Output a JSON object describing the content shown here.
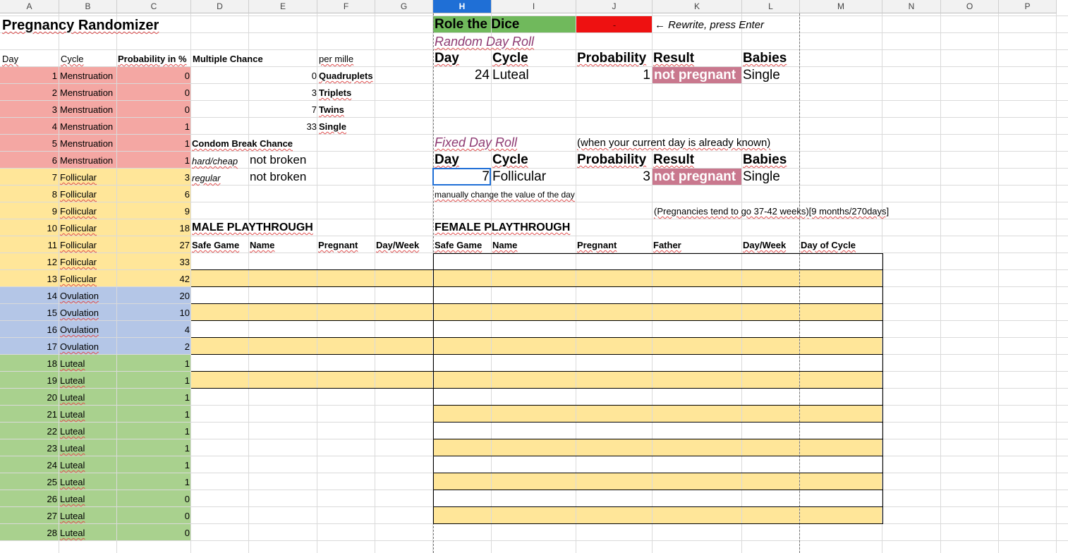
{
  "columns": [
    "A",
    "B",
    "C",
    "D",
    "E",
    "F",
    "G",
    "H",
    "I",
    "J",
    "K",
    "L",
    "M",
    "N",
    "O",
    "P"
  ],
  "selected_column": "H",
  "title": "Pregnancy Randomizer",
  "left_table": {
    "headers": {
      "day": "Day",
      "cycle": "Cycle",
      "probability": "Probability in %"
    },
    "rows": [
      {
        "day": "1",
        "cycle": "Menstruation",
        "prob": "0"
      },
      {
        "day": "2",
        "cycle": "Menstruation",
        "prob": "0"
      },
      {
        "day": "3",
        "cycle": "Menstruation",
        "prob": "0"
      },
      {
        "day": "4",
        "cycle": "Menstruation",
        "prob": "1"
      },
      {
        "day": "5",
        "cycle": "Menstruation",
        "prob": "1"
      },
      {
        "day": "6",
        "cycle": "Menstruation",
        "prob": "1"
      },
      {
        "day": "7",
        "cycle": "Follicular",
        "prob": "3"
      },
      {
        "day": "8",
        "cycle": "Follicular",
        "prob": "6"
      },
      {
        "day": "9",
        "cycle": "Follicular",
        "prob": "9"
      },
      {
        "day": "10",
        "cycle": "Follicular",
        "prob": "18"
      },
      {
        "day": "11",
        "cycle": "Follicular",
        "prob": "27"
      },
      {
        "day": "12",
        "cycle": "Follicular",
        "prob": "33"
      },
      {
        "day": "13",
        "cycle": "Follicular",
        "prob": "42"
      },
      {
        "day": "14",
        "cycle": "Ovulation",
        "prob": "20"
      },
      {
        "day": "15",
        "cycle": "Ovulation",
        "prob": "10"
      },
      {
        "day": "16",
        "cycle": "Ovulation",
        "prob": "4"
      },
      {
        "day": "17",
        "cycle": "Ovulation",
        "prob": "2"
      },
      {
        "day": "18",
        "cycle": "Luteal",
        "prob": "1"
      },
      {
        "day": "19",
        "cycle": "Luteal",
        "prob": "1"
      },
      {
        "day": "20",
        "cycle": "Luteal",
        "prob": "1"
      },
      {
        "day": "21",
        "cycle": "Luteal",
        "prob": "1"
      },
      {
        "day": "22",
        "cycle": "Luteal",
        "prob": "1"
      },
      {
        "day": "23",
        "cycle": "Luteal",
        "prob": "1"
      },
      {
        "day": "24",
        "cycle": "Luteal",
        "prob": "1"
      },
      {
        "day": "25",
        "cycle": "Luteal",
        "prob": "1"
      },
      {
        "day": "26",
        "cycle": "Luteal",
        "prob": "0"
      },
      {
        "day": "27",
        "cycle": "Luteal",
        "prob": "0"
      },
      {
        "day": "28",
        "cycle": "Luteal",
        "prob": "0"
      }
    ],
    "phase_colors": {
      "Menstruation": "#f4a7a3",
      "Follicular": "#ffe699",
      "Ovulation": "#b4c6e7",
      "Luteal": "#a9d18e"
    }
  },
  "multiple": {
    "header": "Multiple Chance",
    "unit": "per mille",
    "rows": [
      {
        "value": "0",
        "label": "Quadruplets"
      },
      {
        "value": "3",
        "label": "Triplets"
      },
      {
        "value": "7",
        "label": "Twins"
      },
      {
        "value": "33",
        "label": "Single"
      }
    ]
  },
  "condom": {
    "header": "Condom Break Chance",
    "rows": [
      {
        "label": "hard/cheap",
        "result": "not broken"
      },
      {
        "label": "regular",
        "result": "not broken"
      }
    ]
  },
  "dice": {
    "button": "Role the Dice",
    "input": "-",
    "hint": "← Rewrite, press Enter",
    "button_color": "#70b95c",
    "input_color": "#ee1111"
  },
  "random_roll": {
    "title": "Random Day Roll",
    "headers": {
      "day": "Day",
      "cycle": "Cycle",
      "probability": "Probability",
      "result": "Result",
      "babies": "Babies"
    },
    "day": "24",
    "cycle": "Luteal",
    "probability": "1",
    "result": "not pregnant",
    "babies": "Single"
  },
  "fixed_roll": {
    "title": "Fixed Day Roll",
    "note": "(when your current day is already known)",
    "headers": {
      "day": "Day",
      "cycle": "Cycle",
      "probability": "Probability",
      "result": "Result",
      "babies": "Babies"
    },
    "day": "7",
    "cycle": "Follicular",
    "probability": "3",
    "result": "not pregnant",
    "babies": "Single",
    "manual_note": "manually change the value of the day"
  },
  "result_color": "#c9788e",
  "pregnancy_note": "(Pregnancies tend to go 37-42 weeks)[9 months/270days]",
  "male": {
    "title": "MALE PLAYTHROUGH",
    "headers": [
      "Safe Game",
      "Name",
      "Pregnant",
      "Day/Week"
    ]
  },
  "female": {
    "title": "FEMALE PLAYTHROUGH",
    "headers": [
      "Safe Game",
      "Name",
      "Pregnant",
      "Father",
      "Day/Week",
      "Day of Cycle"
    ]
  }
}
